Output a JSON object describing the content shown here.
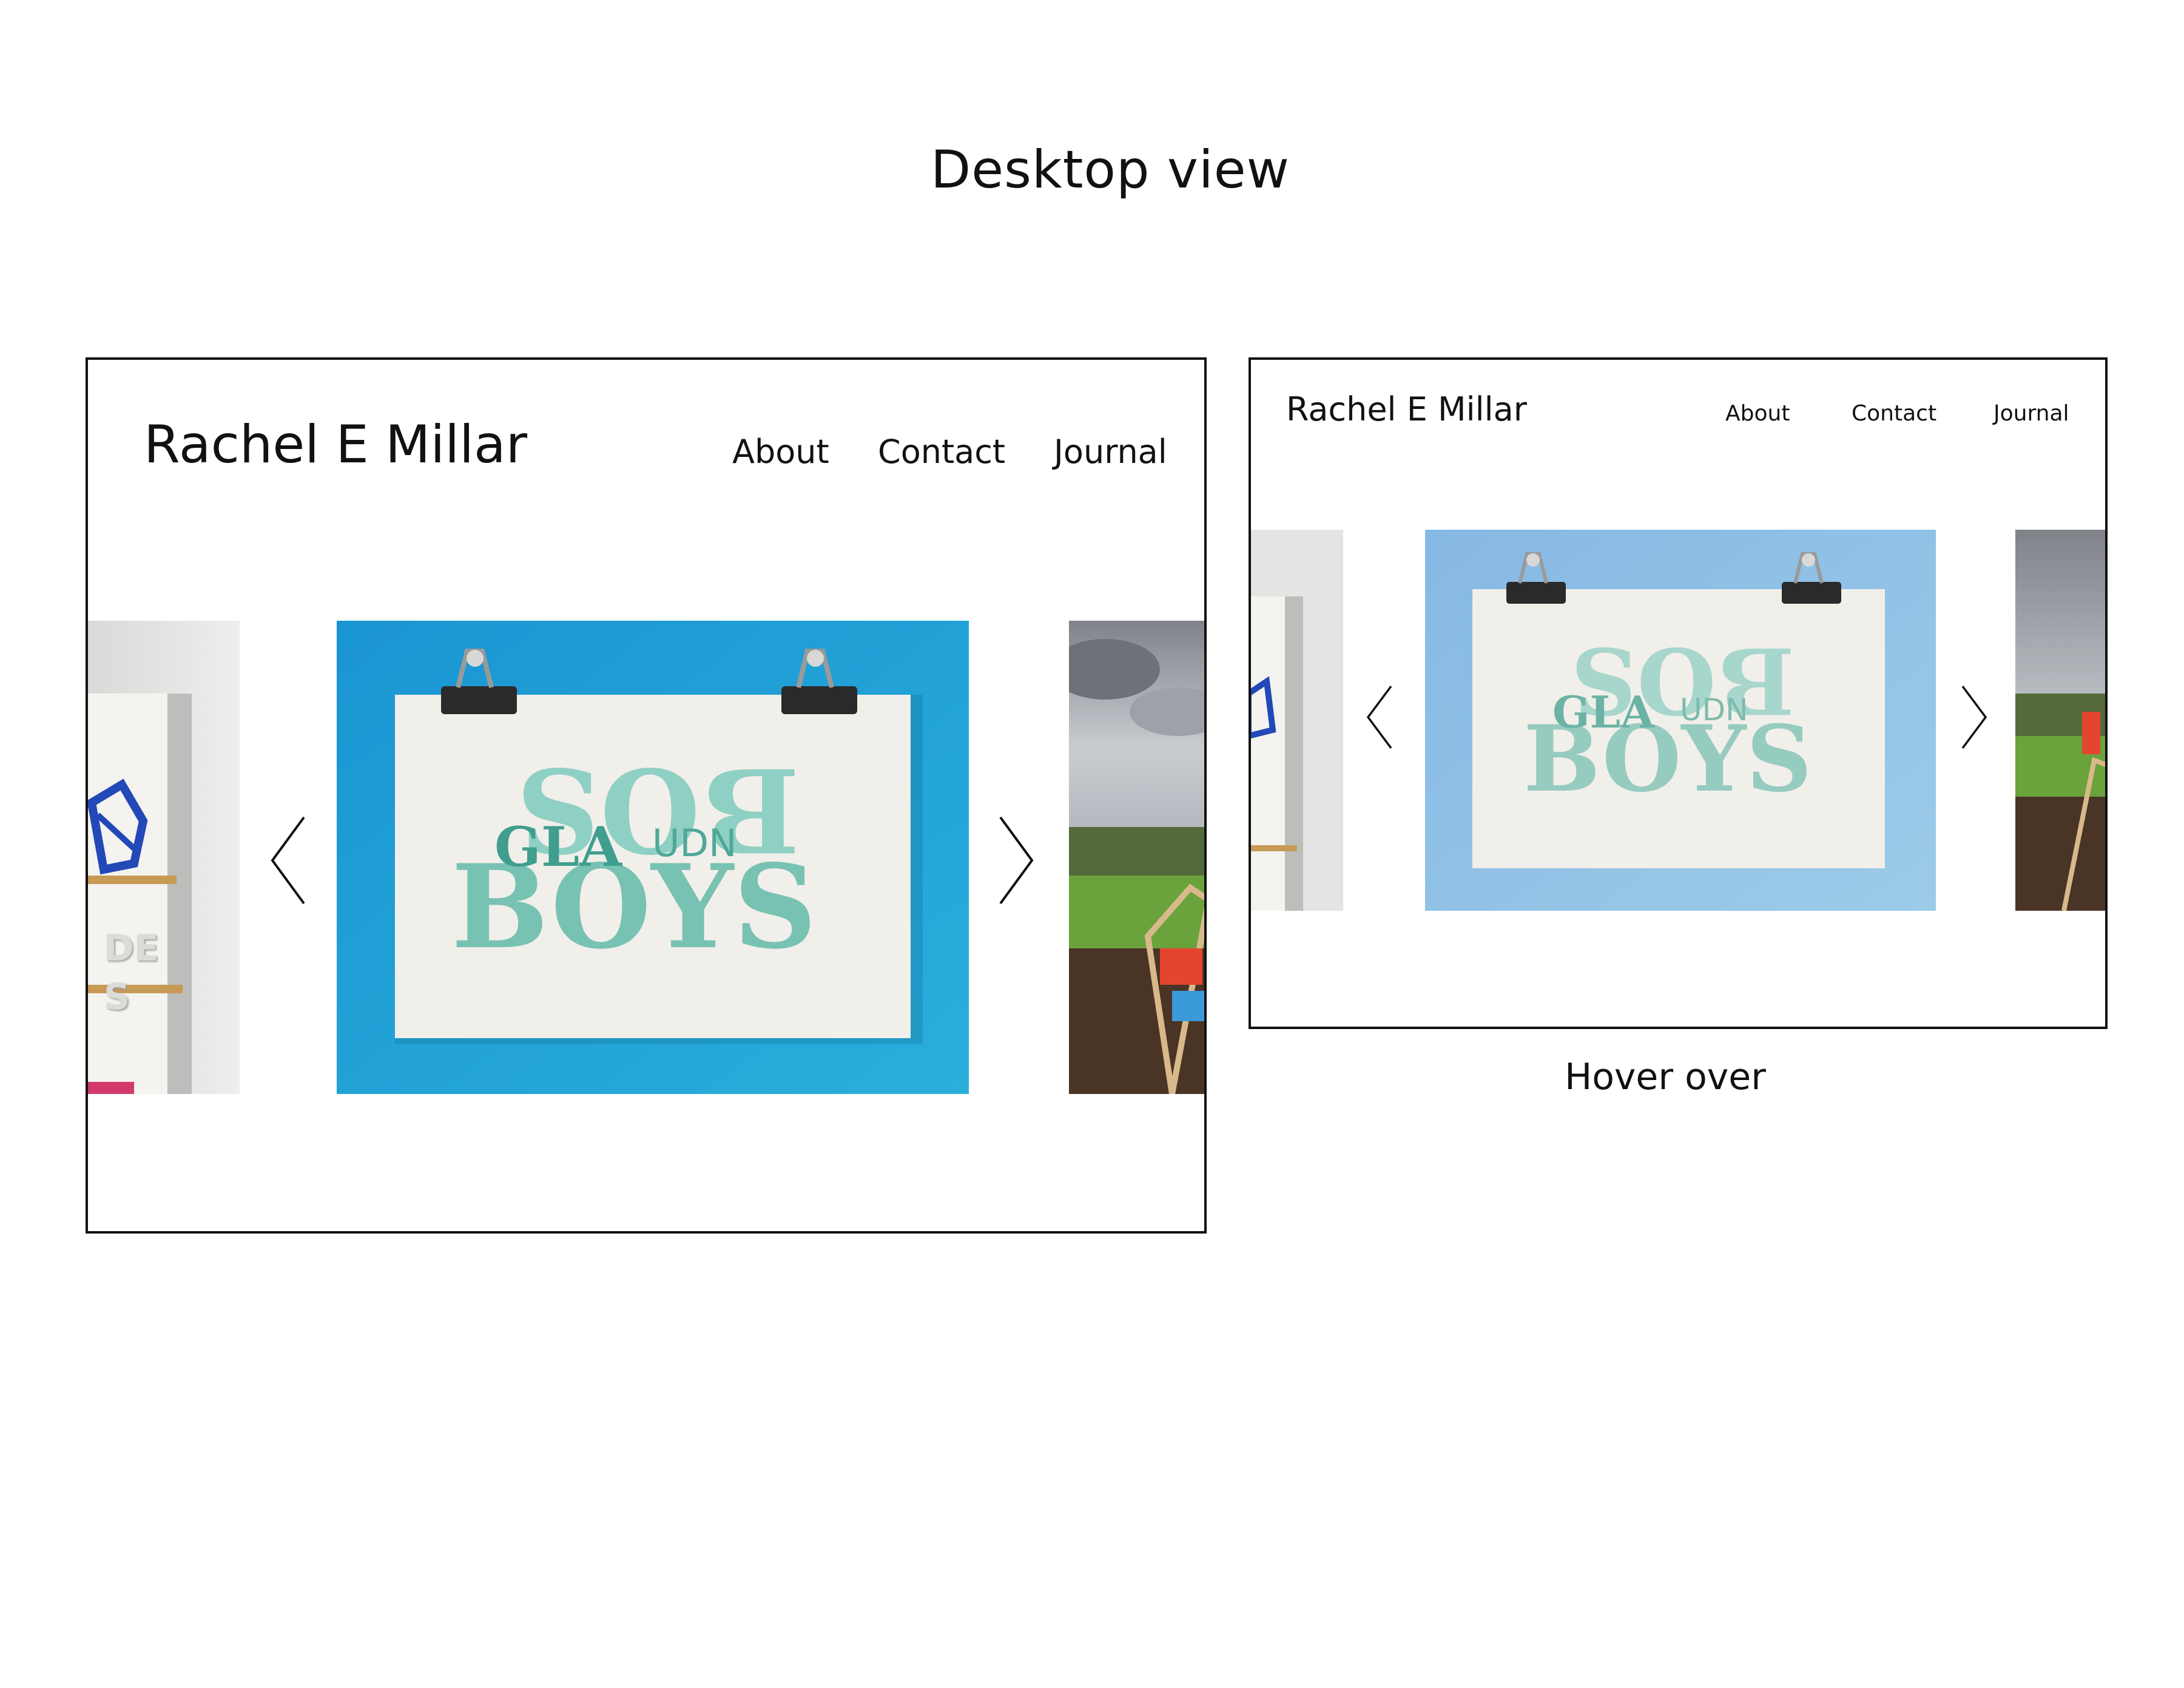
{
  "page": {
    "heading": "Desktop view",
    "caption": "Hover over"
  },
  "site": {
    "brand": "Rachel E Millar",
    "nav": {
      "about": "About",
      "contact": "Contact",
      "journal": "Journal"
    }
  },
  "carousel": {
    "print_text_top": "BOS",
    "print_text_bottom": "BOYS",
    "print_text_inner": "GLA",
    "print_text_small": "UDN",
    "prev_slide_letters": "DE S",
    "colors": {
      "backdrop": "#1e9ed6",
      "backdrop_hover": "#8ec3e6",
      "paper": "#f1efe9",
      "ink": "#5fb7a7"
    }
  },
  "icons": {
    "prev": "chevron-left-icon",
    "next": "chevron-right-icon"
  }
}
